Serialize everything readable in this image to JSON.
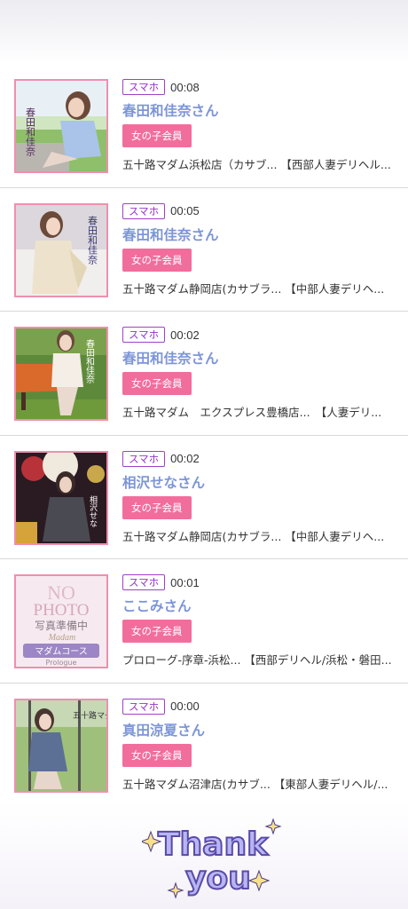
{
  "entries": [
    {
      "device": "スマホ",
      "time": "00:08",
      "name": "春田和佳奈さん",
      "badge": "女の子会員",
      "shop": "五十路マダム浜松店（カサブ... 【西部人妻デリヘル..."
    },
    {
      "device": "スマホ",
      "time": "00:05",
      "name": "春田和佳奈さん",
      "badge": "女の子会員",
      "shop": "五十路マダム静岡店(カサブラ... 【中部人妻デリヘ..."
    },
    {
      "device": "スマホ",
      "time": "00:02",
      "name": "春田和佳奈さん",
      "badge": "女の子会員",
      "shop": "五十路マダム　エクスプレス豊橋店...　【人妻デリ..."
    },
    {
      "device": "スマホ",
      "time": "00:02",
      "name": "相沢せなさん",
      "badge": "女の子会員",
      "shop": "五十路マダム静岡店(カサブラ... 【中部人妻デリヘ..."
    },
    {
      "device": "スマホ",
      "time": "00:01",
      "name": "ここみさん",
      "badge": "女の子会員",
      "shop": "プロローグ-序章-浜松... 【西部デリヘル/浜松・磐田..."
    },
    {
      "device": "スマホ",
      "time": "00:00",
      "name": "真田涼夏さん",
      "badge": "女の子会員",
      "shop": "五十路マダム沼津店(カサブ... 【東部人妻デリヘル/..."
    }
  ],
  "thumb_text": {
    "t1": "春田和佳奈",
    "t2": "春田和佳奈",
    "t3": "春田和佳奈",
    "t4": "相沢せな",
    "noPhoto1": "NO",
    "noPhoto2": "PHOTO",
    "noPhoto3": "写真準備中",
    "noPhoto4": "Madam",
    "noPhoto5": "マダムコース",
    "noPhoto6": "Prologue",
    "t6": "五十路マダム"
  },
  "footer": {
    "thankyou_line1": "Thank",
    "thankyou_line2": "you"
  },
  "colors": {
    "accent": "#7c95d8",
    "badge_pink": "#f16e9c",
    "device_purple": "#9a32c6"
  }
}
